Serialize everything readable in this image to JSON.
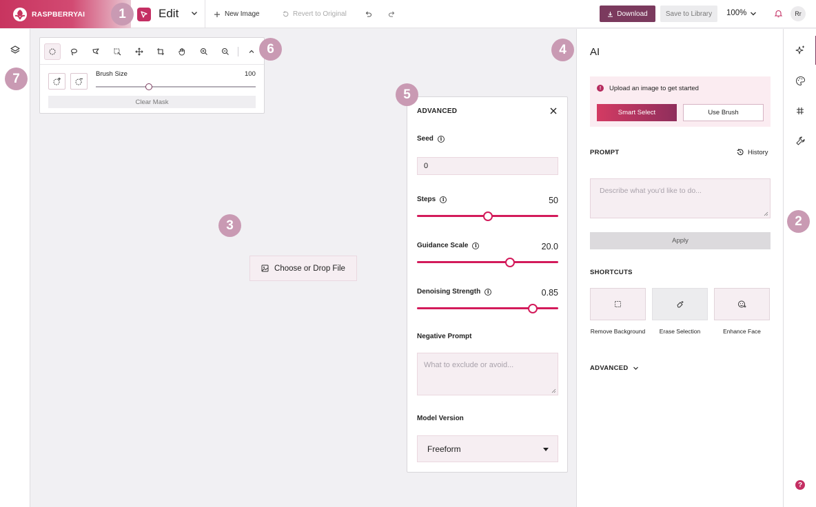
{
  "header": {
    "brand": "RASPBERRYAI",
    "mode": "Edit",
    "new_image": "New Image",
    "revert": "Revert to Original",
    "download": "Download",
    "save_library": "Save to Library",
    "zoom": "100%",
    "avatar": "Rr"
  },
  "tools": {
    "icons": [
      "ellipse-select-icon",
      "lasso-icon",
      "polygon-lasso-icon",
      "magic-select-icon",
      "move-icon",
      "crop-icon",
      "hand-icon",
      "zoom-in-icon",
      "zoom-out-icon",
      "collapse-icon"
    ],
    "active_index": 0,
    "brush_size_label": "Brush Size",
    "brush_size_value": "100",
    "brush_size_fraction": 0.33,
    "clear_mask": "Clear Mask"
  },
  "canvas": {
    "choose_file": "Choose or Drop File"
  },
  "advanced": {
    "title": "ADVANCED",
    "seed_label": "Seed",
    "seed_value": "0",
    "steps_label": "Steps",
    "steps_value": "50",
    "steps_fraction": 0.5,
    "guidance_label": "Guidance Scale",
    "guidance_value": "20.0",
    "guidance_fraction": 0.66,
    "denoise_label": "Denoising Strength",
    "denoise_value": "0.85",
    "denoise_fraction": 0.82,
    "negative_label": "Negative Prompt",
    "negative_placeholder": "What to exclude or avoid...",
    "model_label": "Model Version",
    "model_value": "Freeform"
  },
  "ai_panel": {
    "title": "AI",
    "notice": "Upload an image to get started",
    "smart_select": "Smart Select",
    "use_brush": "Use Brush",
    "prompt_heading": "PROMPT",
    "history": "History",
    "prompt_placeholder": "Describe what you'd like to do...",
    "apply": "Apply",
    "shortcuts_heading": "SHORTCUTS",
    "shortcuts": [
      {
        "label": "Remove Background",
        "icon": "select-dashed-icon"
      },
      {
        "label": "Erase Selection",
        "icon": "eraser-icon"
      },
      {
        "label": "Enhance Face",
        "icon": "face-icon"
      }
    ],
    "advanced_toggle": "ADVANCED"
  },
  "callouts": [
    "1",
    "2",
    "3",
    "4",
    "5",
    "6",
    "7"
  ],
  "colors": {
    "brand": "#c42f63",
    "accent_dark": "#7b3a5e",
    "slider": "#d31a5a",
    "callout": "#c99ab3"
  }
}
